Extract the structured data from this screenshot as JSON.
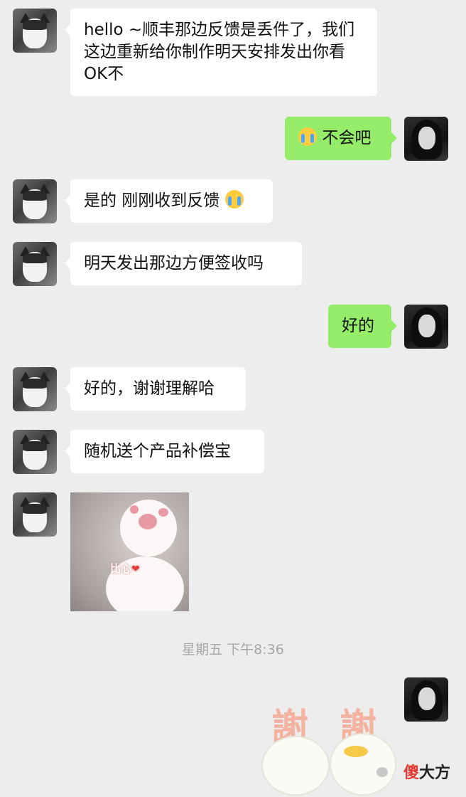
{
  "messages": [
    {
      "side": "left",
      "text": "hello ~顺丰那边反馈是丢件了，我们这边重新给你制作明天安排发出你看OK不"
    },
    {
      "side": "right",
      "text": "不会吧",
      "emoji": "crying-face"
    },
    {
      "side": "left",
      "text": "是的 刚刚收到反馈",
      "emoji": "crying-face"
    },
    {
      "side": "left",
      "text": "明天发出那边方便签收吗"
    },
    {
      "side": "right",
      "text": "好的"
    },
    {
      "side": "left",
      "text": "好的，谢谢理解哈"
    },
    {
      "side": "left",
      "text": "随机送个产品补偿宝"
    }
  ],
  "sticker": {
    "caption": "比心",
    "heart": "❤"
  },
  "timestamp": "星期五 下午8:36",
  "thanks_sticker": {
    "char1": "謝",
    "char2": "謝"
  },
  "watermark": {
    "brand_red": "傻",
    "brand_rest": "大方"
  },
  "colors": {
    "background": "#ededed",
    "incoming_bubble": "#ffffff",
    "outgoing_bubble": "#95ec69",
    "timestamp": "#a6a6a6"
  }
}
